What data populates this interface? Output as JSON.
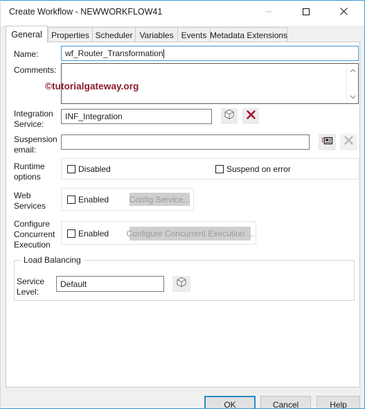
{
  "window": {
    "title": "Create Workflow - NEWWORKFLOW41",
    "controls": {
      "minimize": "minimize-icon",
      "maximize": "maximize-icon",
      "close": "close-icon"
    },
    "accent_color": "#3d9ad1"
  },
  "tabs": [
    {
      "label": "General",
      "active": true
    },
    {
      "label": "Properties",
      "active": false
    },
    {
      "label": "Scheduler",
      "active": false
    },
    {
      "label": "Variables",
      "active": false
    },
    {
      "label": "Events",
      "active": false
    },
    {
      "label": "Metadata Extensions",
      "active": false
    }
  ],
  "form": {
    "name": {
      "label": "Name:",
      "value": "wf_Router_Transformation",
      "placeholder": "",
      "focused": true
    },
    "comments": {
      "label": "Comments:",
      "value": "",
      "placeholder": ""
    },
    "integration_service": {
      "label": "Integration\nService:",
      "value": "INF_Integration",
      "placeholder": "",
      "browse_icon": "cube-icon",
      "clear_icon": "red-x-icon"
    },
    "suspension_email": {
      "label": "Suspension\nemail:",
      "value": "",
      "placeholder": "",
      "email_icon": "email-card-icon",
      "clear_icon": "grey-x-icon"
    },
    "runtime_options": {
      "label": "Runtime\noptions",
      "disabled_checkbox": {
        "label": "Disabled",
        "checked": false
      },
      "suspend_on_error_checkbox": {
        "label": "Suspend on error",
        "checked": false
      }
    },
    "web_services": {
      "label": "Web\nServices",
      "enabled_checkbox": {
        "label": "Enabled",
        "checked": false
      },
      "config_button": {
        "label": "Config Service...",
        "disabled": true
      }
    },
    "concurrent_execution": {
      "label": "Configure\nConcurrent\nExecution",
      "enabled_checkbox": {
        "label": "Enabled",
        "checked": false
      },
      "config_button": {
        "label": "Configure Concurrent Execution ...",
        "disabled": true
      }
    },
    "load_balancing": {
      "group_title": "Load Balancing",
      "service_level": {
        "label": "Service\nLevel:",
        "value": "Default",
        "placeholder": "",
        "browse_icon": "cube-icon"
      }
    }
  },
  "watermark": {
    "text": "©tutorialgateway.org",
    "color": "#8b1a2b"
  },
  "footer": {
    "ok": "OK",
    "cancel": "Cancel",
    "help": "Help"
  }
}
